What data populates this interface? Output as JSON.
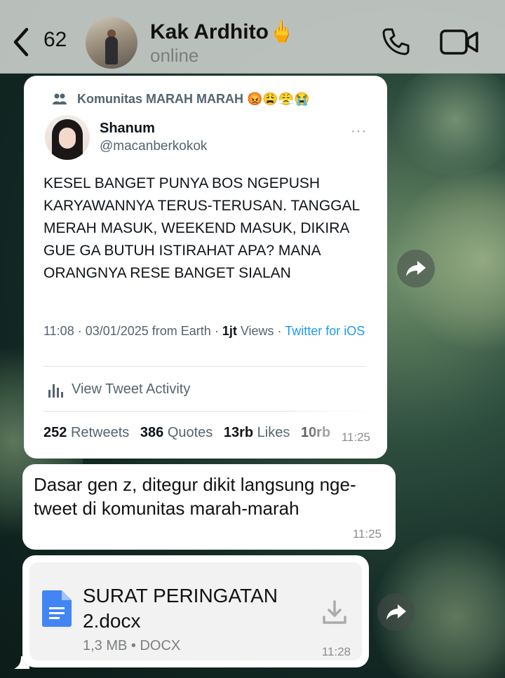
{
  "header": {
    "unread_count": "62",
    "contact_name": "Kak Ardhito",
    "name_emoji": "🖕",
    "status": "online"
  },
  "tweet": {
    "community": "Komunitas MARAH MARAH 😡😩😤😭",
    "author_name": "Shanum",
    "author_handle": "@macanberkokok",
    "more": "···",
    "body": "KESEL BANGET PUNYA BOS NGEPUSH KARYAWANNYA TERUS-TERUSAN. TANGGAL MERAH MASUK, WEEKEND MASUK, DIKIRA GUE GA BUTUH ISTIRAHAT APA? MANA ORANGNYA RESE BANGET SIALAN",
    "meta_time": "11:08 · 03/01/2025 from Earth · ",
    "meta_views_num": "1jt",
    "meta_views_label": " Views · ",
    "meta_source": "Twitter for iOS",
    "activity_label": "View Tweet Activity",
    "retweets_num": "252",
    "retweets_label": "Retweets",
    "quotes_num": "386",
    "quotes_label": "Quotes",
    "likes_num": "13rb",
    "likes_label": "Likes",
    "bookmarks_num": "10rb",
    "time": "11:25"
  },
  "message": {
    "text": "Dasar gen z, ditegur dikit langsung nge-tweet di komunitas marah-marah",
    "time": "11:25"
  },
  "document": {
    "name": "SURAT PERINGATAN 2.docx",
    "meta": "1,3 MB • DOCX",
    "time": "11:28"
  },
  "colors": {
    "header_bg": "#c4c9c5",
    "bubble": "#ffffff",
    "link": "#1d9bf0",
    "doc_icon": "#4285f4"
  },
  "icons": [
    "chevron-left-icon",
    "phone-icon",
    "video-camera-icon",
    "community-icon",
    "more-dots-icon",
    "bar-chart-icon",
    "forward-icon",
    "document-icon",
    "download-icon"
  ]
}
